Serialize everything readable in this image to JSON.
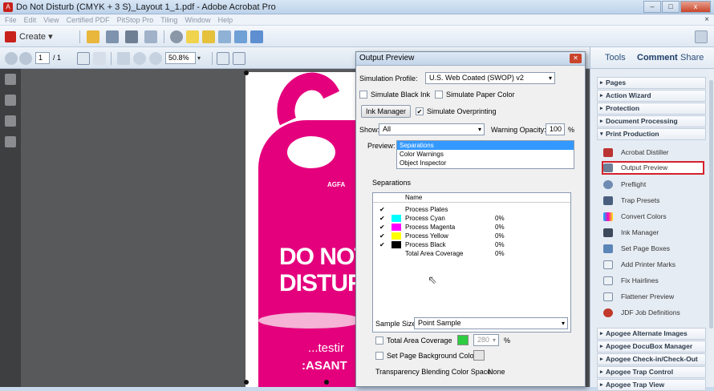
{
  "window": {
    "title": "Do Not Disturb (CMYK + 3 S)_Layout 1_1.pdf - Adobe Acrobat Pro",
    "close_glyph": "x"
  },
  "menu": [
    "File",
    "Edit",
    "View",
    "Certified PDF",
    "PitStop Pro",
    "Tiling",
    "Window",
    "Help"
  ],
  "toolbar": {
    "create_label": "Create ▾",
    "page_current": "1",
    "page_total": "/ 1",
    "zoom": "50.8%"
  },
  "document": {
    "brand": "AGFA",
    "line1": "DO NOT",
    "line2": "DISTURB",
    "line3": "...testir",
    "line4": ":ASANT"
  },
  "dialog": {
    "title": "Output Preview",
    "simulation_profile_label": "Simulation Profile:",
    "simulation_profile_value": "U.S. Web Coated (SWOP) v2",
    "simulate_black_ink": "Simulate Black Ink",
    "simulate_paper_color": "Simulate Paper Color",
    "ink_manager_button": "Ink Manager",
    "simulate_overprinting": "Simulate Overprinting",
    "show_label": "Show:",
    "show_value": "All",
    "warning_opacity_label": "Warning Opacity:",
    "warning_opacity_value": "100",
    "percent": "%",
    "preview_label": "Preview:",
    "preview_options": [
      "Separations",
      "Color Warnings",
      "Object Inspector"
    ],
    "separations_label": "Separations",
    "sep_name_header": "Name",
    "separations": [
      {
        "name": "Process Plates",
        "checked": "✔",
        "color": "",
        "pct": ""
      },
      {
        "name": "Process Cyan",
        "checked": "✔",
        "color": "#00ffff",
        "pct": "0%"
      },
      {
        "name": "Process Magenta",
        "checked": "✔",
        "color": "#ff00ff",
        "pct": "0%"
      },
      {
        "name": "Process Yellow",
        "checked": "✔",
        "color": "#ffff00",
        "pct": "0%"
      },
      {
        "name": "Process Black",
        "checked": "✔",
        "color": "#000000",
        "pct": "0%"
      },
      {
        "name": "Total Area Coverage",
        "checked": "",
        "color": "",
        "pct": "0%"
      }
    ],
    "sample_size_label": "Sample Size:",
    "sample_size_value": "Point Sample",
    "total_area_coverage": "Total Area Coverage",
    "tac_value": "280",
    "set_page_bg": "Set Page Background Color",
    "transparency_label": "Transparency Blending Color Space:",
    "transparency_value": "None"
  },
  "right_panel": {
    "tabs": [
      "Tools",
      "Comment",
      "Share"
    ],
    "sections_top": [
      "Pages",
      "Action Wizard",
      "Protection",
      "Document Processing",
      "Print Production"
    ],
    "print_production_items": [
      "Acrobat Distiller",
      "Output Preview",
      "Preflight",
      "Trap Presets",
      "Convert Colors",
      "Ink Manager",
      "Set Page Boxes",
      "Add Printer Marks",
      "Fix Hairlines",
      "Flattener Preview",
      "JDF Job Definitions"
    ],
    "sections_bottom": [
      "Apogee Alternate Images",
      "Apogee DocuBox Manager",
      "Apogee Check-in/Check-Out",
      "Apogee Trap Control",
      "Apogee Trap View"
    ]
  }
}
